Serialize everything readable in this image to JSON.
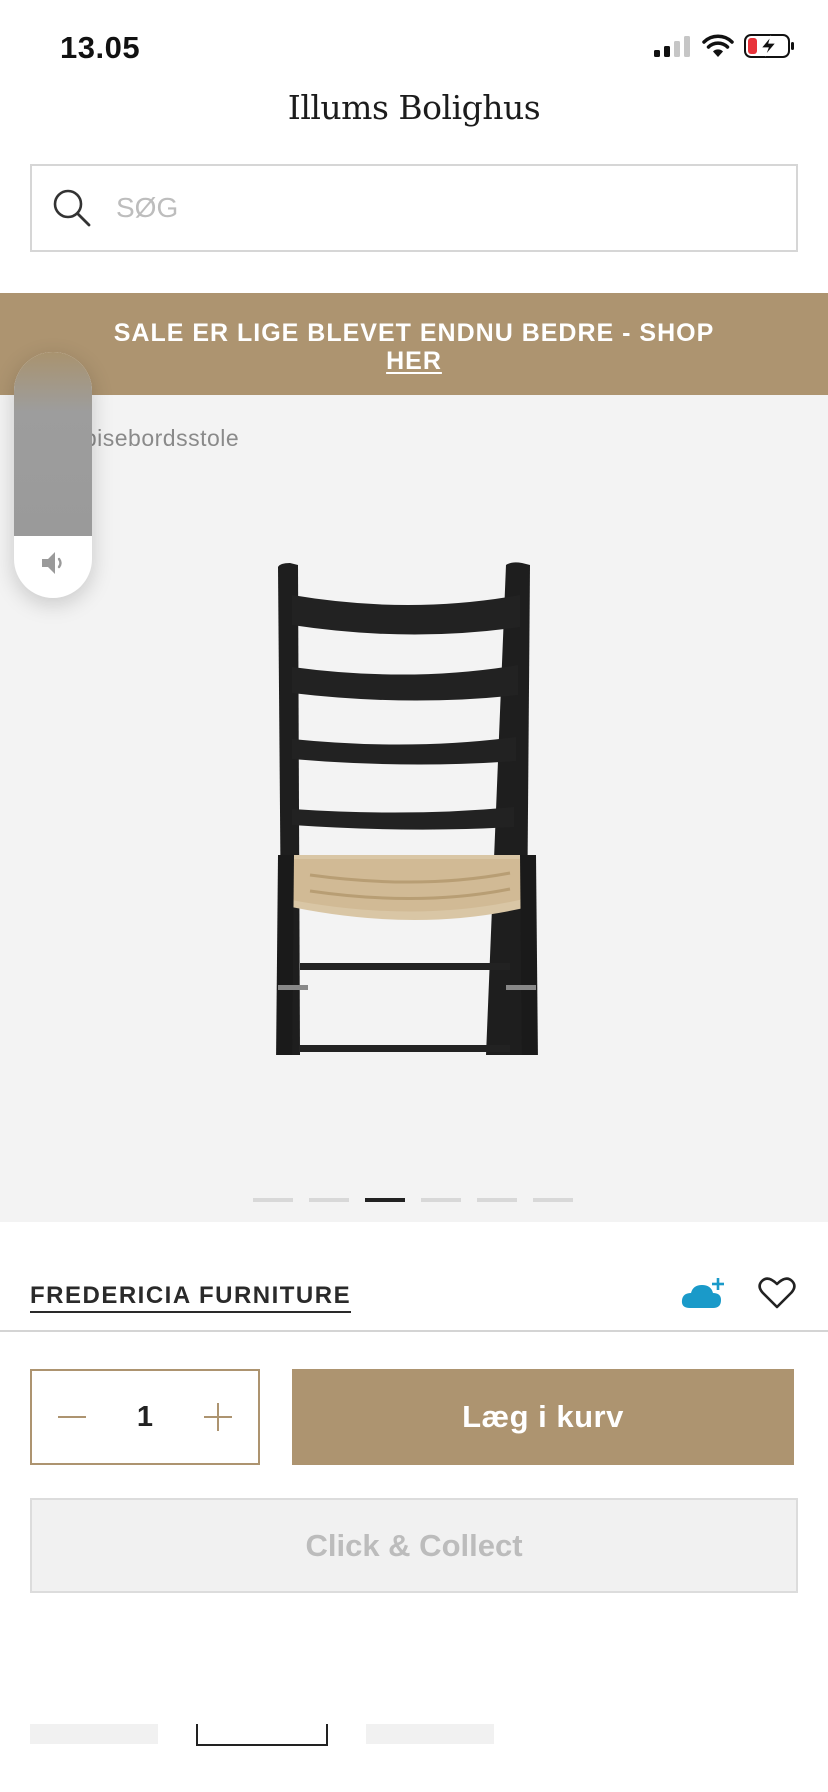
{
  "status_bar": {
    "time": "13.05"
  },
  "header": {
    "logo_text": "Illums Bolighus"
  },
  "search": {
    "placeholder": "SØG",
    "icon": "search-icon"
  },
  "banner": {
    "text": "SALE ER LIGE BLEVET ENDNU BEDRE - SHOP",
    "link": "HER",
    "background": "#ad9470"
  },
  "gallery": {
    "breadcrumb": "Spisebordsstole",
    "image_count": 6,
    "active_index": 2
  },
  "product": {
    "brand": "FREDERICIA FURNITURE",
    "quantity": "1",
    "add_to_cart_label": "Læg i kurv",
    "click_collect_label": "Click & Collect"
  },
  "colors": {
    "accent": "#ad9470",
    "cloud": "#1a9ac9"
  }
}
